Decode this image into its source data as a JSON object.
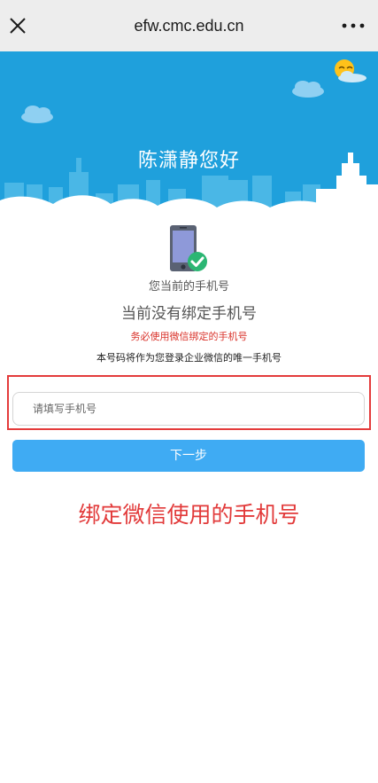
{
  "browser": {
    "url_title": "efw.cmc.edu.cn",
    "close_icon": "close-icon",
    "more_icon": "more-dots-icon"
  },
  "banner": {
    "greeting": "陈潇静您好",
    "background_color": "#1fa0dc"
  },
  "status": {
    "phone_icon": "phone-check-icon",
    "current_phone_label": "您当前的手机号",
    "not_bound_text": "当前没有绑定手机号",
    "warning_text": "务必使用微信绑定的手机号",
    "note_text": "本号码将作为您登录企业微信的唯一手机号"
  },
  "form": {
    "phone_input": {
      "value": "",
      "placeholder": "请填写手机号"
    },
    "next_button_label": "下一步",
    "button_color": "#3fabf3"
  },
  "annotation": {
    "text": "绑定微信使用的手机号",
    "color": "#e23a3a"
  }
}
